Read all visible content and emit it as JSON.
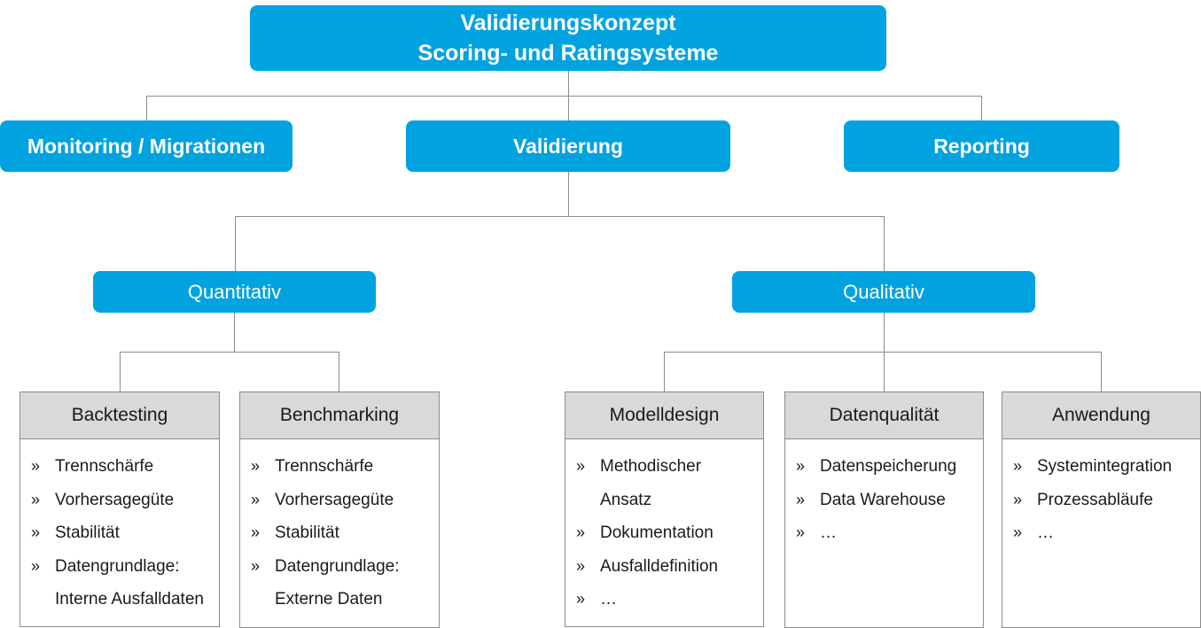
{
  "root": {
    "line1": "Validierungskonzept",
    "line2": "Scoring- und Ratingsysteme"
  },
  "level1": {
    "monitoring": "Monitoring / Migrationen",
    "validierung": "Validierung",
    "reporting": "Reporting"
  },
  "level2": {
    "quantitativ": "Quantitativ",
    "qualitativ": "Qualitativ"
  },
  "bullet": "»",
  "cards": [
    {
      "title": "Backtesting",
      "items": [
        "Trennschärfe",
        "Vorhersagegüte",
        "Stabilität",
        "Datengrundlage: Interne Ausfalldaten"
      ]
    },
    {
      "title": "Benchmarking",
      "items": [
        "Trennschärfe",
        "Vorhersagegüte",
        "Stabilität",
        "Datengrundlage: Externe Daten"
      ]
    },
    {
      "title": "Modelldesign",
      "items": [
        "Methodischer Ansatz",
        "Dokumentation",
        "Ausfalldefinition",
        "…"
      ]
    },
    {
      "title": "Datenqualität",
      "items": [
        "Datenspeicherung",
        "Data Warehouse",
        "…"
      ]
    },
    {
      "title": "Anwendung",
      "items": [
        "Systemintegration",
        "Prozessabläufe",
        "…"
      ]
    }
  ],
  "colors": {
    "accent": "#00a3e0",
    "header_gray": "#d9d9d9",
    "connector": "#8c8c8c"
  }
}
